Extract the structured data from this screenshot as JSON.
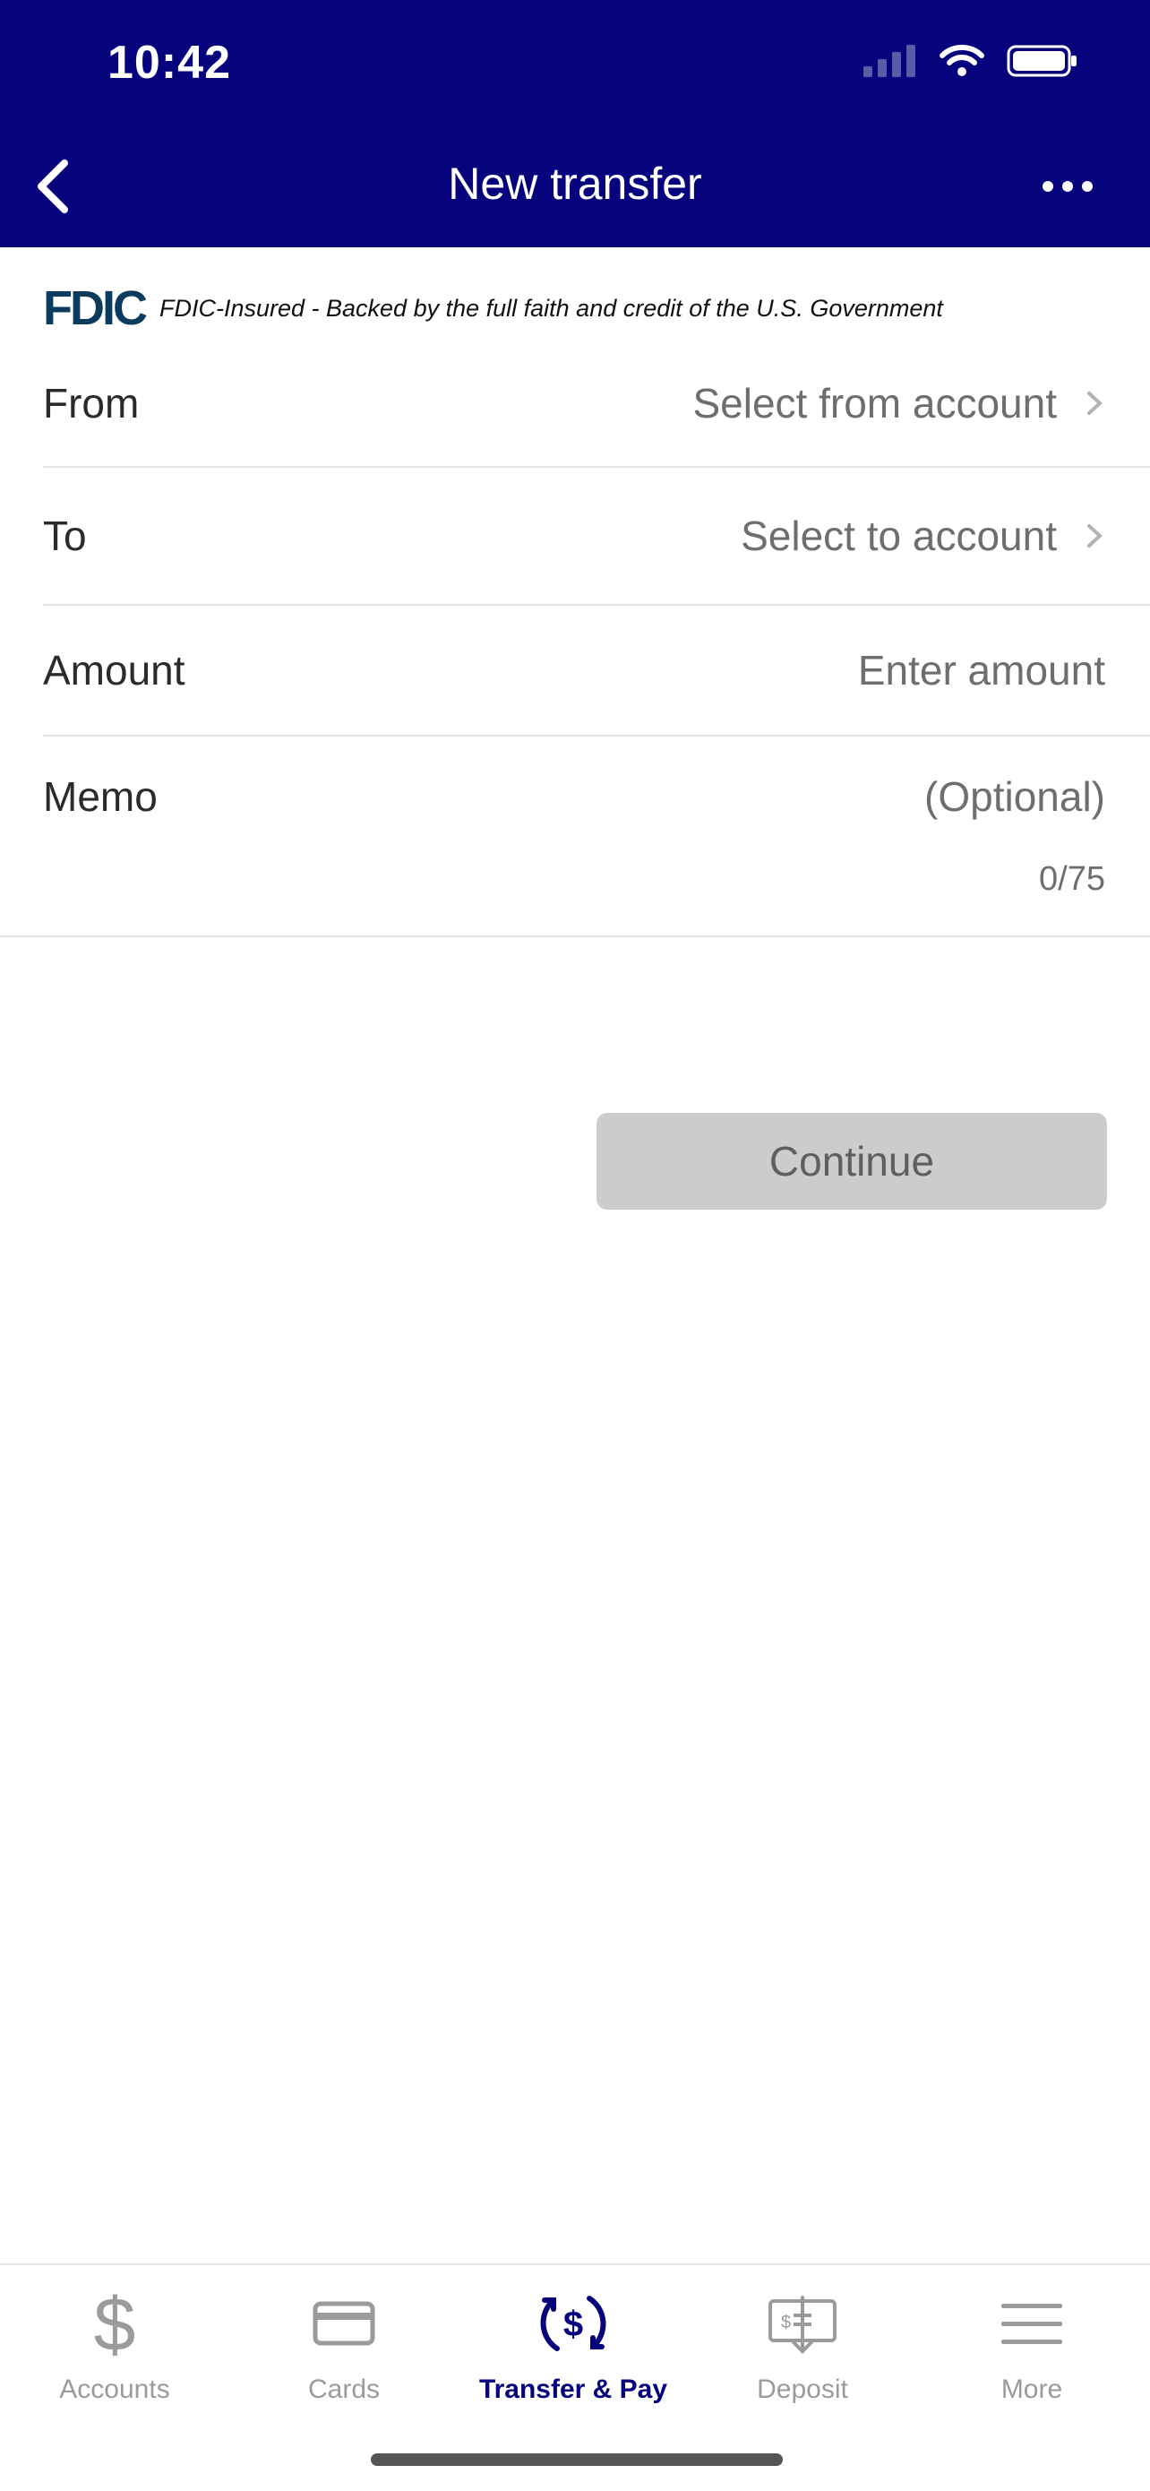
{
  "status_bar": {
    "time": "10:42"
  },
  "header": {
    "title": "New transfer"
  },
  "fdic": {
    "logo": "FDIC",
    "text": "FDIC-Insured - Backed by the full faith and credit of the U.S. Government"
  },
  "form": {
    "from": {
      "label": "From",
      "value": "Select from account"
    },
    "to": {
      "label": "To",
      "value": "Select to account"
    },
    "amount": {
      "label": "Amount",
      "placeholder": "Enter amount"
    },
    "memo": {
      "label": "Memo",
      "placeholder": "(Optional)",
      "counter": "0/75"
    }
  },
  "actions": {
    "continue_label": "Continue"
  },
  "tabbar": {
    "items": [
      {
        "label": "Accounts",
        "icon": "dollar-icon"
      },
      {
        "label": "Cards",
        "icon": "card-icon"
      },
      {
        "label": "Transfer & Pay",
        "icon": "transfer-icon",
        "active": true
      },
      {
        "label": "Deposit",
        "icon": "check-deposit-icon"
      },
      {
        "label": "More",
        "icon": "hamburger-icon"
      }
    ]
  },
  "colors": {
    "primary": "#06037d",
    "disabled_button": "#cccccc"
  }
}
